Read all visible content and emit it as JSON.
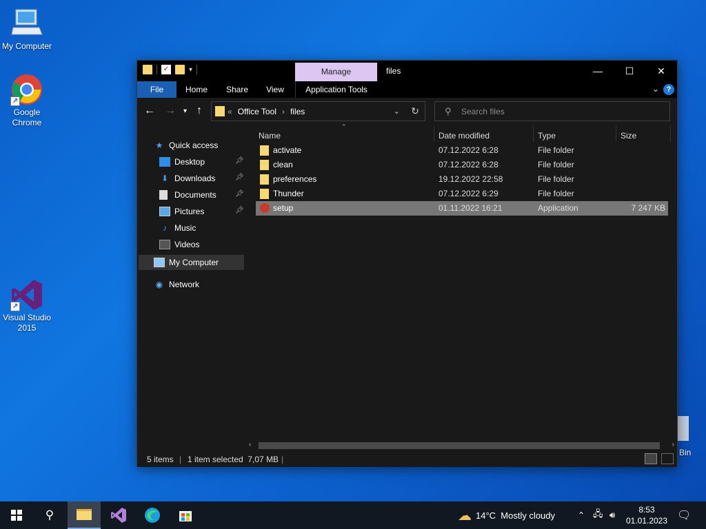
{
  "desktop": {
    "icons": [
      {
        "label": "My Computer",
        "icon": "computer-icon"
      },
      {
        "label": "Google Chrome",
        "icon": "chrome-icon"
      },
      {
        "label": "Visual Studio 2015",
        "icon": "visual-studio-icon"
      },
      {
        "label": "Bin",
        "icon": "recycle-bin-icon"
      }
    ]
  },
  "window": {
    "title": "files",
    "manage_tab": "Manage",
    "controls": {
      "minimize": "—",
      "maximize": "☐",
      "close": "✕"
    },
    "ribbon_tabs": [
      "File",
      "Home",
      "Share",
      "View",
      "Application Tools"
    ],
    "help": "?",
    "collapse": "⌄"
  },
  "address": {
    "prefix": "«",
    "crumbs": [
      "Office Tool",
      "files"
    ],
    "separator": "›"
  },
  "search": {
    "placeholder": "Search files"
  },
  "nav": {
    "quick_access": "Quick access",
    "items": [
      "Desktop",
      "Downloads",
      "Documents",
      "Pictures",
      "Music",
      "Videos"
    ],
    "my_computer": "My Computer",
    "network": "Network"
  },
  "columns": {
    "name": "Name",
    "date": "Date modified",
    "type": "Type",
    "size": "Size"
  },
  "files": [
    {
      "name": "activate",
      "date": "07.12.2022 6:28",
      "type": "File folder",
      "size": ""
    },
    {
      "name": "clean",
      "date": "07.12.2022 6:28",
      "type": "File folder",
      "size": ""
    },
    {
      "name": "preferences",
      "date": "19.12.2022 22:58",
      "type": "File folder",
      "size": ""
    },
    {
      "name": "Thunder",
      "date": "07.12.2022 6:29",
      "type": "File folder",
      "size": ""
    },
    {
      "name": "setup",
      "date": "01.11.2022 16:21",
      "type": "Application",
      "size": "7 247 KB"
    }
  ],
  "status": {
    "items": "5 items",
    "selected": "1 item selected  7,07 MB"
  },
  "taskbar": {
    "weather": "14°C  Mostly cloudy",
    "time": "8:53",
    "date": "01.01.2023"
  },
  "colors": {
    "accent": "#1a5fb4",
    "manage_tab": "#ddc6f2",
    "folder": "#f8d775",
    "selected_row": "#777777"
  }
}
